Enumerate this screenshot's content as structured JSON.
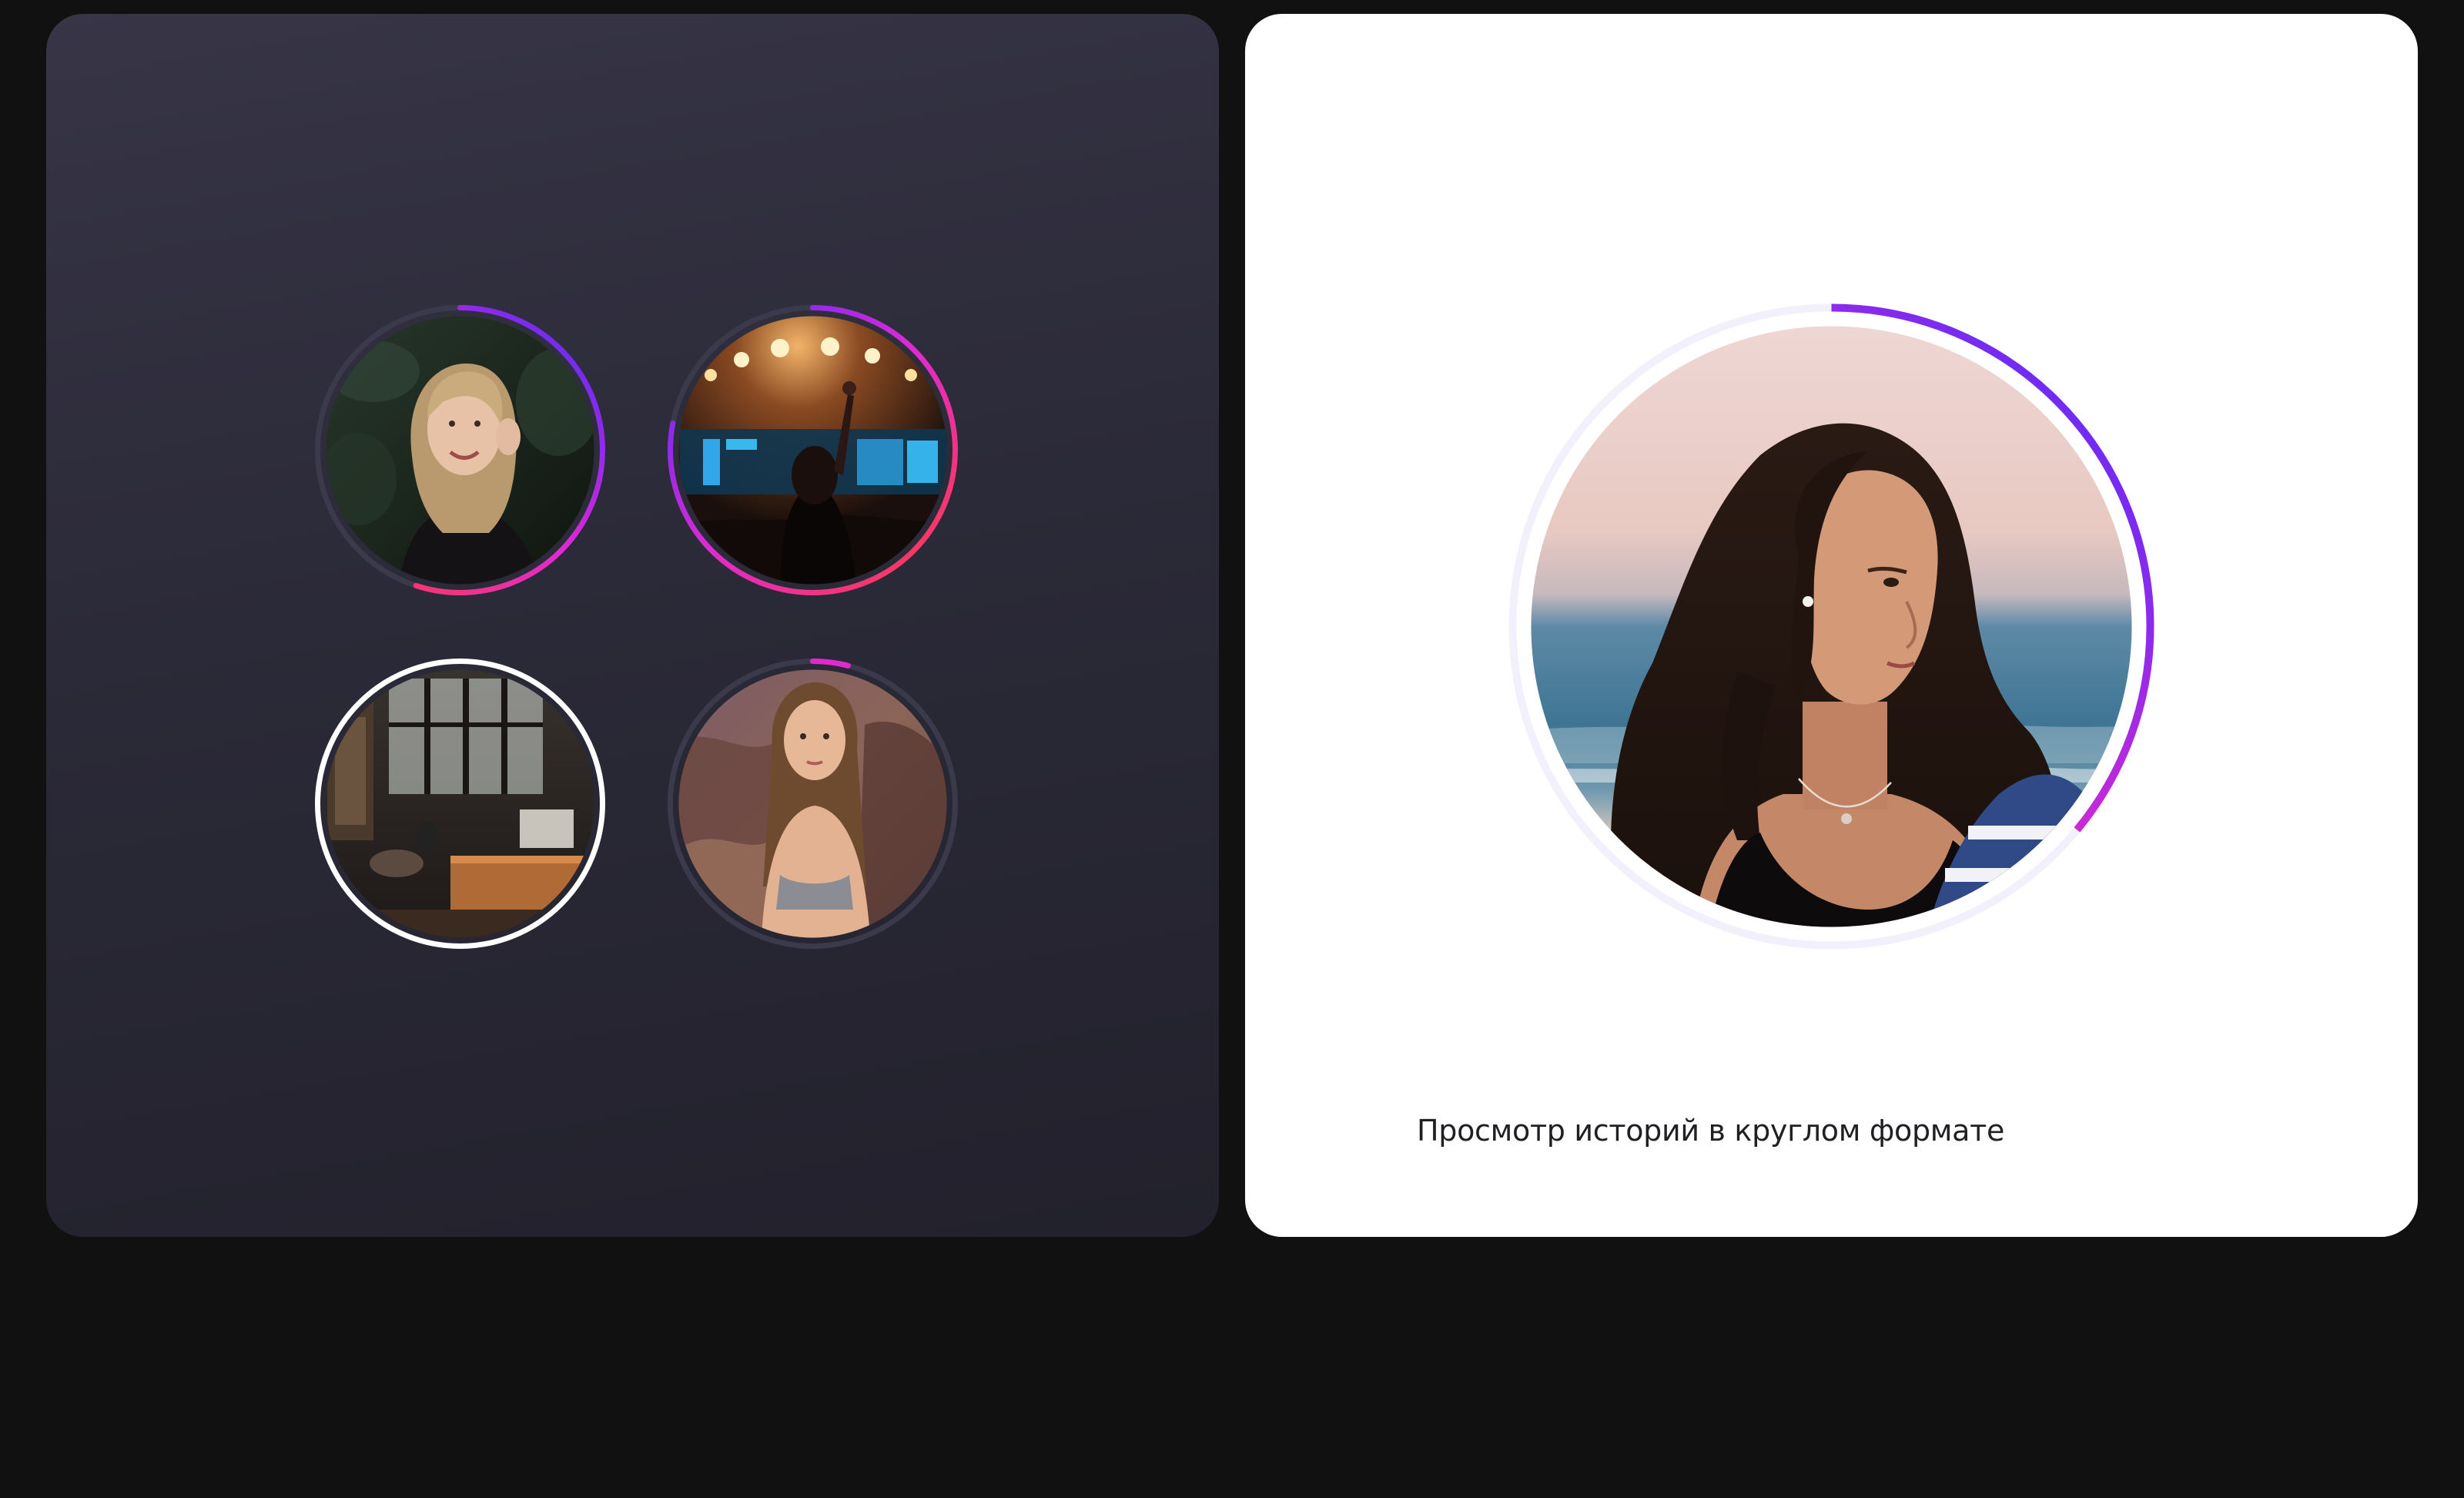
{
  "caption": "Просмотр историй в круглом формате",
  "colors": {
    "background": "#111111",
    "dark_card": "#2d2c3a",
    "light_card": "#ffffff",
    "gradient": [
      "#ff3d3d",
      "#e02ad1",
      "#4b2bff"
    ],
    "inactive_ring": "#3b3a4c",
    "viewed_ring": "#ffffff",
    "track_light": "#eeedfb"
  },
  "stories": [
    {
      "photo": "blonde-woman-portrait",
      "state": "unviewed",
      "progress": 0.55
    },
    {
      "photo": "concert-crowd",
      "state": "unviewed",
      "progress": 0.78
    },
    {
      "photo": "cafe-interior",
      "state": "viewed",
      "progress": 0
    },
    {
      "photo": "woman-rocks-portrait",
      "state": "in-progress",
      "progress": 0.04
    }
  ],
  "player": {
    "photo": "woman-beach-portrait",
    "progress": 0.36
  }
}
